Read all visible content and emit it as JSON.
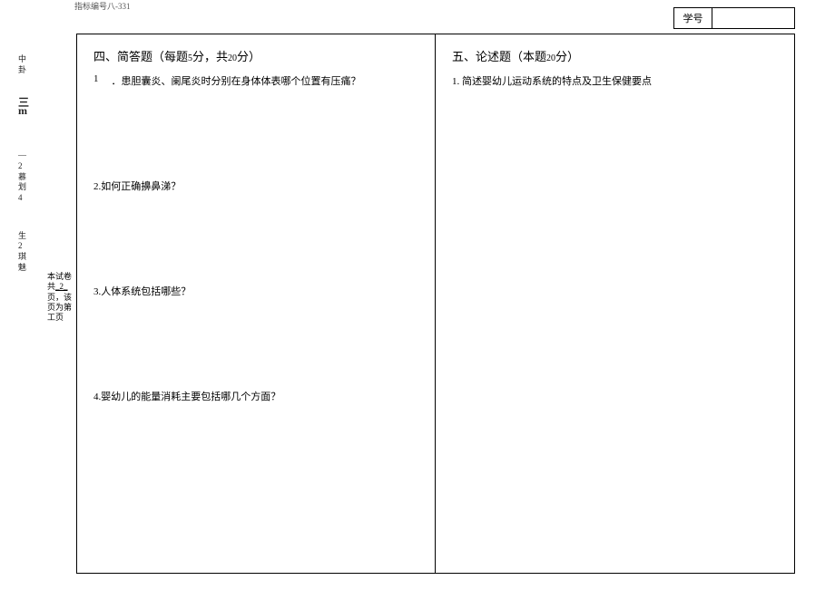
{
  "top_code": "指标编号八‐331",
  "student_id": {
    "label": "学号",
    "value": ""
  },
  "left_margin": {
    "block1": [
      "中",
      "卦"
    ],
    "block2_bars": [
      "三",
      "m"
    ],
    "block3": [
      "―",
      "2",
      "慕",
      "划",
      "4"
    ],
    "block4": [
      "生",
      "2",
      "琪",
      "魅"
    ]
  },
  "page_note": {
    "l1": "本试卷",
    "l2_pre": "共",
    "l2_num": "_2_",
    "l3": "页，该",
    "l4": "页为第",
    "l5": "工页"
  },
  "section4": {
    "title": "四、简答题（每题",
    "title_pts": "5",
    "title_mid": "分，共",
    "title_total": "20",
    "title_end": "分）",
    "q1_num": "1",
    "q1_text": "．患胆囊炎、阑尾炎时分别在身体体表哪个位置有压痛？",
    "q2_text": "2.如何正确擤鼻涕？",
    "q3_text": "3.人体系统包括哪些？",
    "q4_text": "4.婴幼儿的能量消耗主要包括哪几个方面？"
  },
  "section5": {
    "title": "五、论述题（本题",
    "title_total": "20",
    "title_end": "分）",
    "q1_text": "1. 简述婴幼儿运动系统的特点及卫生保健要点"
  }
}
